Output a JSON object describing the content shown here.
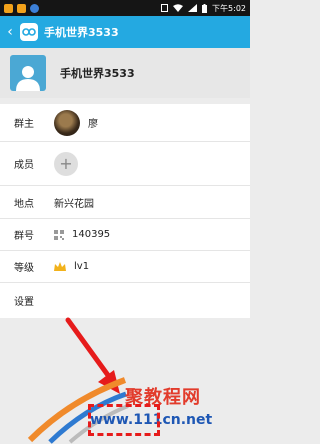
{
  "status_bar": {
    "time": "下午5:02",
    "icons": [
      "app-notification-icon",
      "app-notification-icon",
      "shield-icon",
      "clipboard-icon",
      "wifi-icon",
      "signal-icon",
      "battery-icon"
    ]
  },
  "app_bar": {
    "back_icon": "chevron-left-icon",
    "logo_icon": "qq-group-logo-icon",
    "title": "手机世界3533"
  },
  "group_header": {
    "avatar_icon": "default-avatar-icon",
    "name": "手机世界3533"
  },
  "info_rows": {
    "owner": {
      "label": "群主",
      "name": "廖"
    },
    "members": {
      "label": "成员",
      "add_icon": "plus-icon"
    },
    "location": {
      "label": "地点",
      "value": "新兴花园"
    },
    "group_number": {
      "label": "群号",
      "value": "140395",
      "icon": "qr-code-icon"
    },
    "level": {
      "label": "等级",
      "value": "lv1",
      "icon": "crown-icon"
    },
    "settings": {
      "label": "设置"
    }
  },
  "watermark": {
    "text": "聚教程网",
    "url": "www.111cn.net"
  },
  "colors": {
    "app_bar": "#24a9e1",
    "status_bar": "#151515",
    "annotation_red": "#e61b1b"
  }
}
